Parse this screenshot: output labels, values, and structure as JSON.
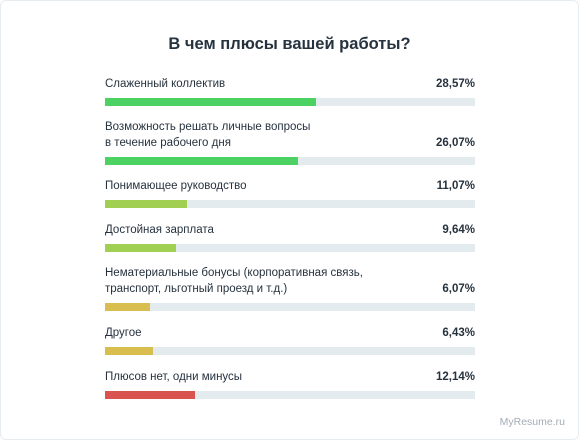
{
  "chart_data": {
    "type": "bar",
    "orientation": "horizontal",
    "title": "В чем плюсы вашей работы?",
    "xlim": [
      0,
      50
    ],
    "categories": [
      "Слаженный коллектив",
      "Возможность решать личные вопросы\nв течение рабочего дня",
      "Понимающее руководство",
      "Достойная зарплата",
      "Нематериальные бонусы (корпоративная связь,\nтранспорт, льготный проезд и т.д.)",
      "Другое",
      "Плюсов нет, одни минусы"
    ],
    "values": [
      28.57,
      26.07,
      11.07,
      9.64,
      6.07,
      6.43,
      12.14
    ],
    "value_labels": [
      "28,57%",
      "26,07%",
      "11,07%",
      "9,64%",
      "6,07%",
      "6,43%",
      "12,14%"
    ],
    "bar_colors": [
      "#4cd263",
      "#4cd263",
      "#a1cf52",
      "#a1cf52",
      "#d7be4e",
      "#d7be4e",
      "#d9534f"
    ],
    "track_color": "#e3ebef"
  },
  "watermark": "MyResume.ru"
}
